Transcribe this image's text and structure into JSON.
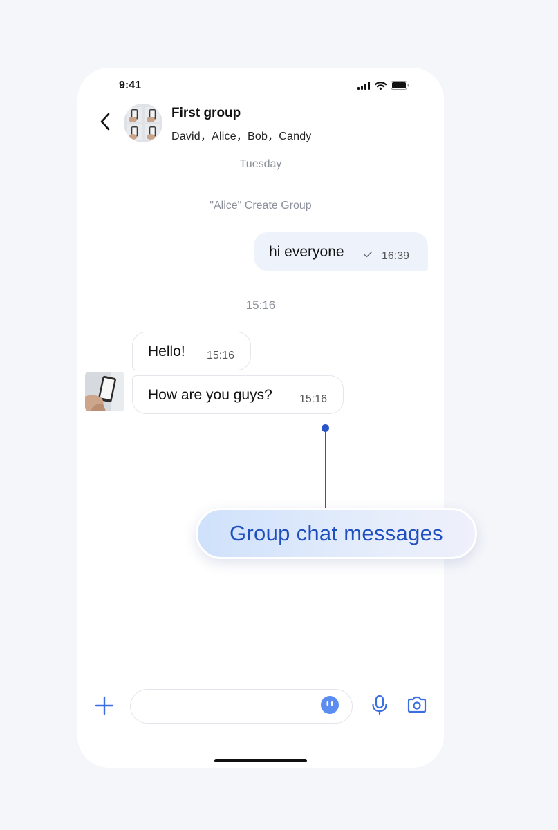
{
  "status_bar": {
    "time": "9:41",
    "icons": [
      "cellular-signal-icon",
      "wifi-icon",
      "battery-icon"
    ]
  },
  "header": {
    "back_icon": "chevron-left-icon",
    "title": "First group",
    "members": "David，Alice，Bob，Candy"
  },
  "conversation": {
    "day_label": "Tuesday",
    "system_message": "\"Alice\" Create Group",
    "outgoing": {
      "text": "hi everyone",
      "status_icon": "check-icon",
      "time": "16:39"
    },
    "time_divider": "15:16",
    "incoming": [
      {
        "text": "Hello!",
        "time": "15:16"
      },
      {
        "text": "How are you guys?",
        "time": "15:16"
      }
    ]
  },
  "input_bar": {
    "placeholder": "",
    "icons": [
      "plus-icon",
      "emoji-icon",
      "microphone-icon",
      "camera-icon"
    ]
  },
  "callout": {
    "label": "Group chat messages"
  },
  "colors": {
    "accent": "#3b6fe0",
    "callout_text": "#1f4fbf",
    "outgoing_bubble": "#eef3fb",
    "muted_text": "#8a8f99",
    "page_background": "#f4f6fa"
  }
}
